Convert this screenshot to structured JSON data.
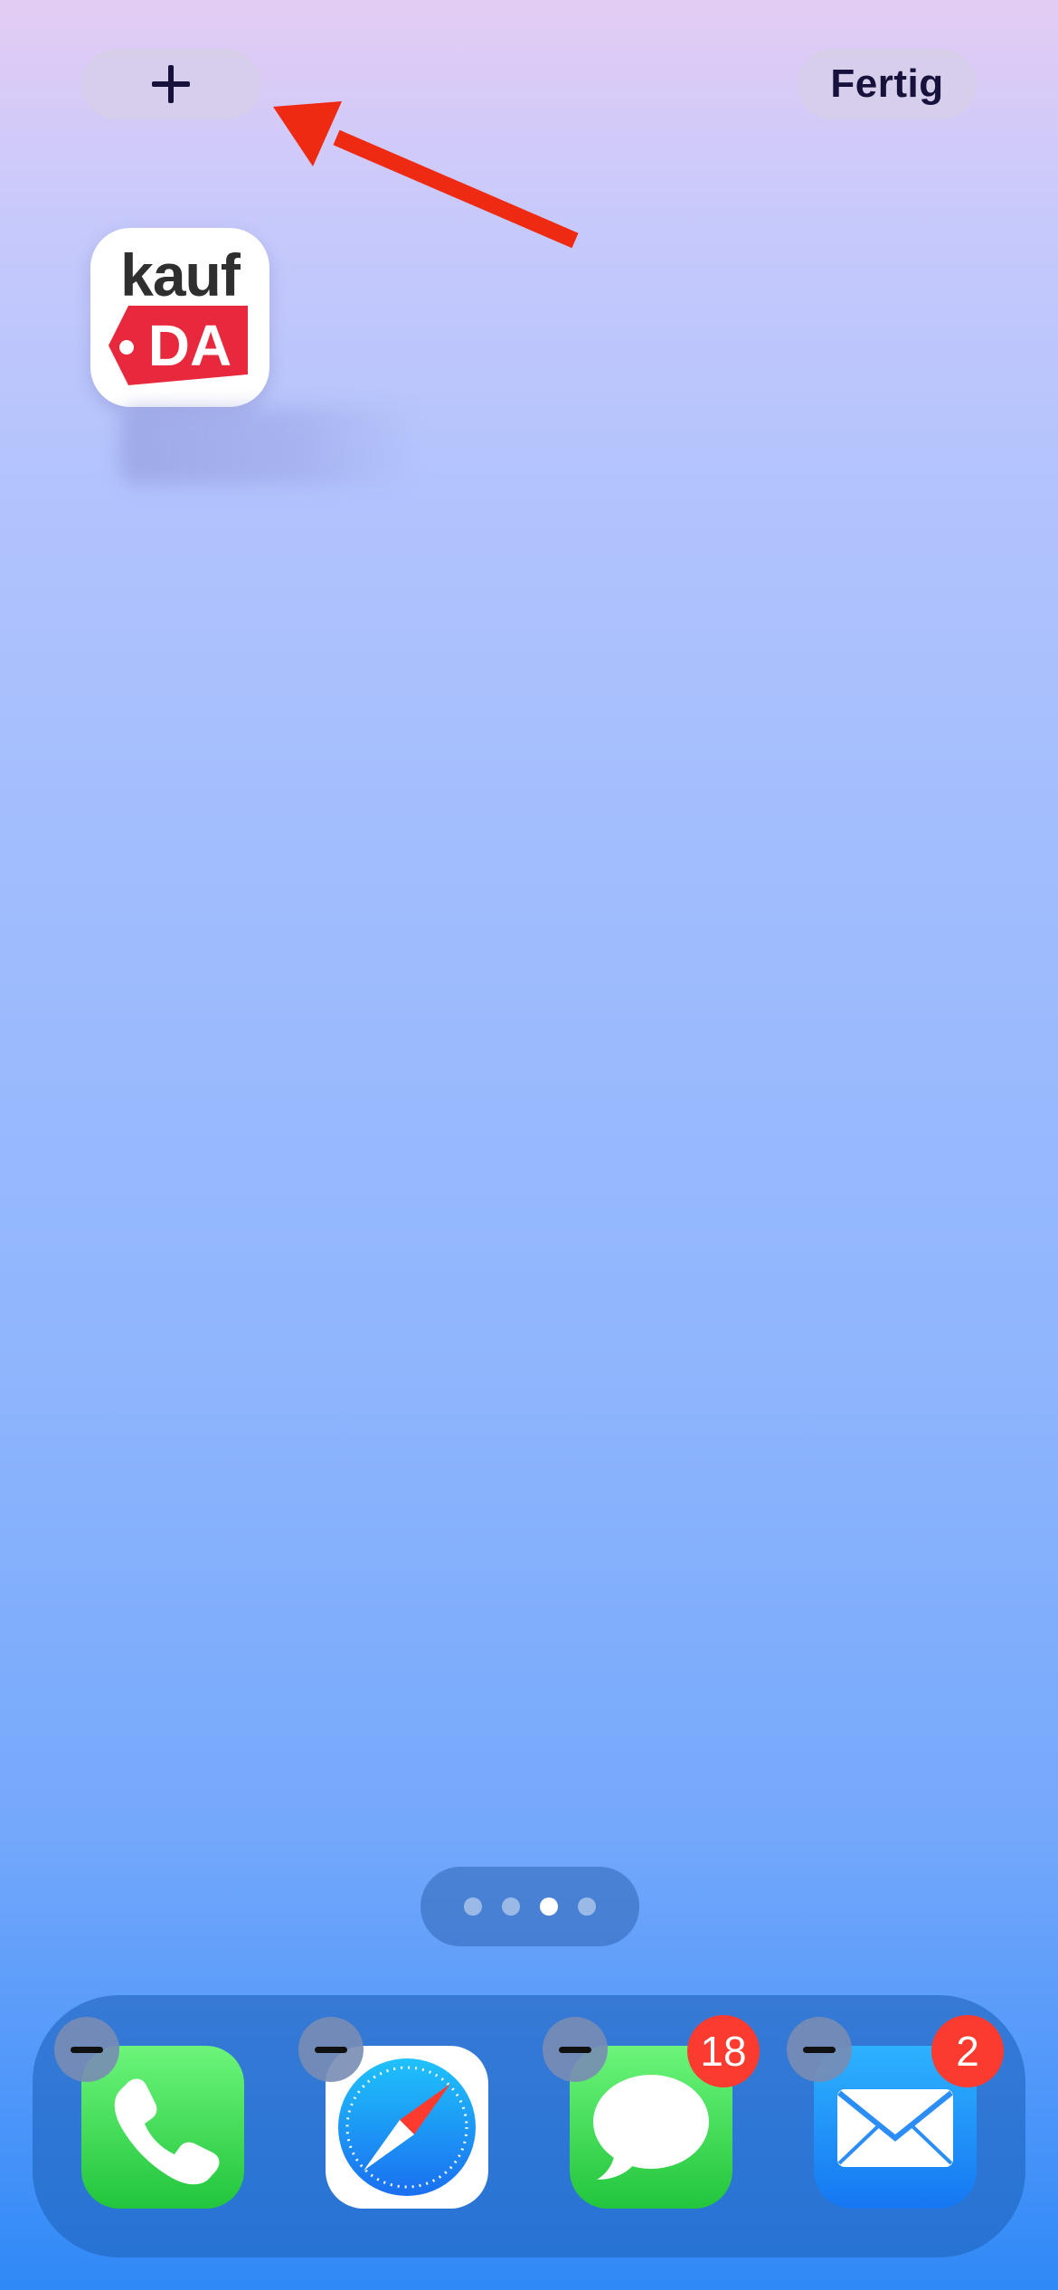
{
  "toolbar": {
    "add_label": "+",
    "done_label": "Fertig"
  },
  "home_app": {
    "logo_text_top": "kauf",
    "logo_text_tag": "DA"
  },
  "page_indicator": {
    "total": 4,
    "current": 3
  },
  "dock": {
    "apps": [
      {
        "icon": "phone-icon",
        "badge": ""
      },
      {
        "icon": "safari-icon",
        "badge": ""
      },
      {
        "icon": "messages-icon",
        "badge": "18"
      },
      {
        "icon": "mail-icon",
        "badge": "2"
      }
    ]
  },
  "colors": {
    "annotation_arrow": "#ee2a12",
    "badge": "#fb3b30",
    "kaufda_red": "#e8283c"
  }
}
